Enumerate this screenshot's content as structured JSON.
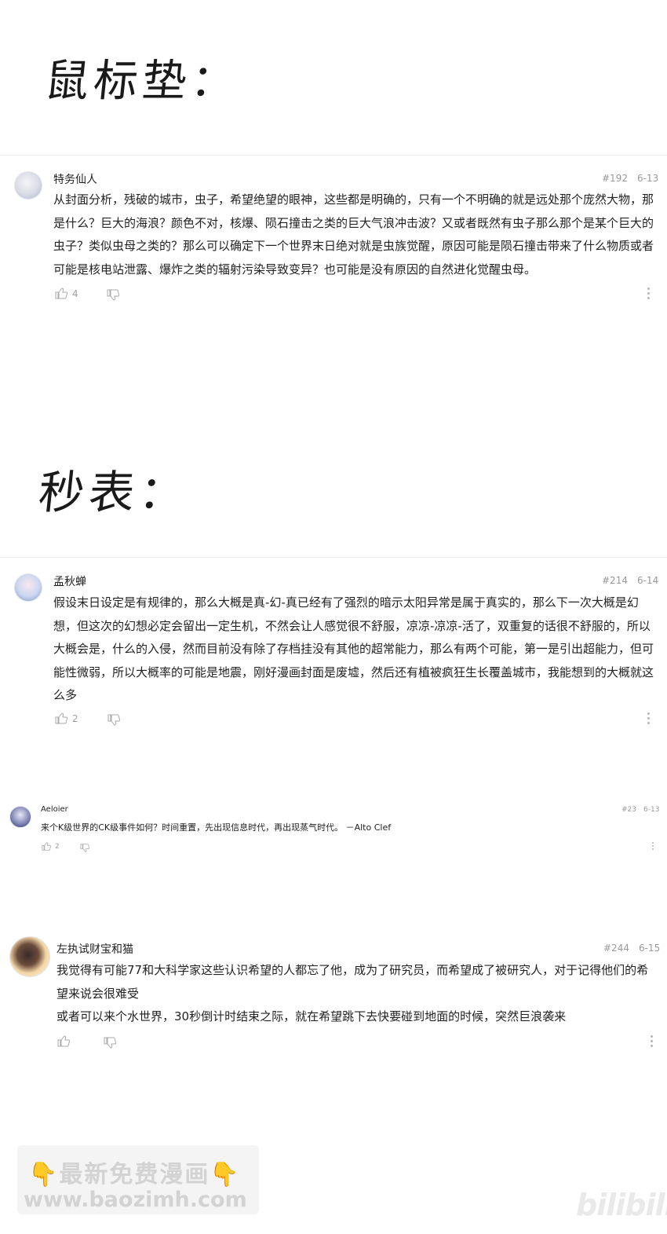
{
  "handwritten_titles": [
    "鼠标垫：",
    "秒表："
  ],
  "comments": [
    {
      "username": "特务仙人",
      "floor": "#192",
      "date": "6-13",
      "text": "从封面分析，残破的城市，虫子，希望绝望的眼神，这些都是明确的，只有一个不明确的就是远处那个庞然大物，那是什么？巨大的海浪？颜色不对，核爆、陨石撞击之类的巨大气浪冲击波？又或者既然有虫子那么那个是某个巨大的虫子？类似虫母之类的？那么可以确定下一个世界末日绝对就是虫族觉醒，原因可能是陨石撞击带来了什么物质或者可能是核电站泄露、爆炸之类的辐射污染导致变异？也可能是没有原因的自然进化觉醒虫母。",
      "likes": "4"
    },
    {
      "username": "孟秋蝉",
      "floor": "#214",
      "date": "6-14",
      "text": "假设末日设定是有规律的，那么大概是真-幻-真已经有了强烈的暗示太阳异常是属于真实的，那么下一次大概是幻想，但这次的幻想必定会留出一定生机，不然会让人感觉很不舒服，凉凉-凉凉-活了，双重复的话很不舒服的，所以大概会是，什么的入侵，然而目前没有除了存档挂没有其他的超常能力，那么有两个可能，第一是引出超能力，但可能性微弱，所以大概率的可能是地震，刚好漫画封面是废墟，然后还有植被疯狂生长覆盖城市，我能想到的大概就这么多",
      "likes": "2"
    },
    {
      "username": "Aeloier",
      "floor": "#23",
      "date": "6-13",
      "text": "来个K级世界的CK级事件如何？时间重置，先出现信息时代，再出现蒸气时代。  －Alto Clef",
      "likes": "2"
    },
    {
      "username": "左执试财宝和猫",
      "floor": "#244",
      "date": "6-15",
      "lines": [
        "我觉得有可能77和大科学家这些认识希望的人都忘了他，成为了研究员，而希望成了被研究人，对于记得他们的希望来说会很难受",
        "或者可以来个水世界，30秒倒计时结束之际，就在希望跳下去快要碰到地面的时候，突然巨浪袭来"
      ],
      "likes": ""
    }
  ],
  "watermark": {
    "line1": "👇最新免费漫画👇",
    "line2": "www.baozimh.com"
  },
  "bilibili_logo": "bilibili"
}
